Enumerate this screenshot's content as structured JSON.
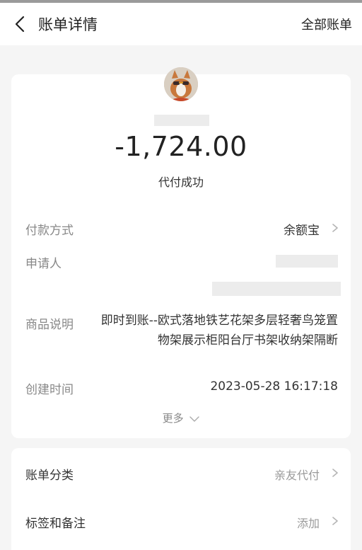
{
  "header": {
    "title": "账单详情",
    "right_link": "全部账单"
  },
  "summary": {
    "amount": "-1,724.00",
    "status": "代付成功"
  },
  "details": {
    "payment_method_label": "付款方式",
    "payment_method_value": "余额宝",
    "applicant_label": "申请人",
    "product_label": "商品说明",
    "product_value": "即时到账--欧式落地铁艺花架多层轻奢鸟笼置物架展示柜阳台厅书架收纳架隔断",
    "created_label": "创建时间",
    "created_value": "2023-05-28 16:17:18",
    "more_label": "更多"
  },
  "extra": {
    "category_label": "账单分类",
    "category_value": "亲友代付",
    "tags_label": "标签和备注",
    "tags_value": "添加"
  },
  "icons": {
    "back": "chevron-left-icon",
    "chevron_right": "chevron-right-icon",
    "chevron_down": "chevron-down-icon"
  }
}
